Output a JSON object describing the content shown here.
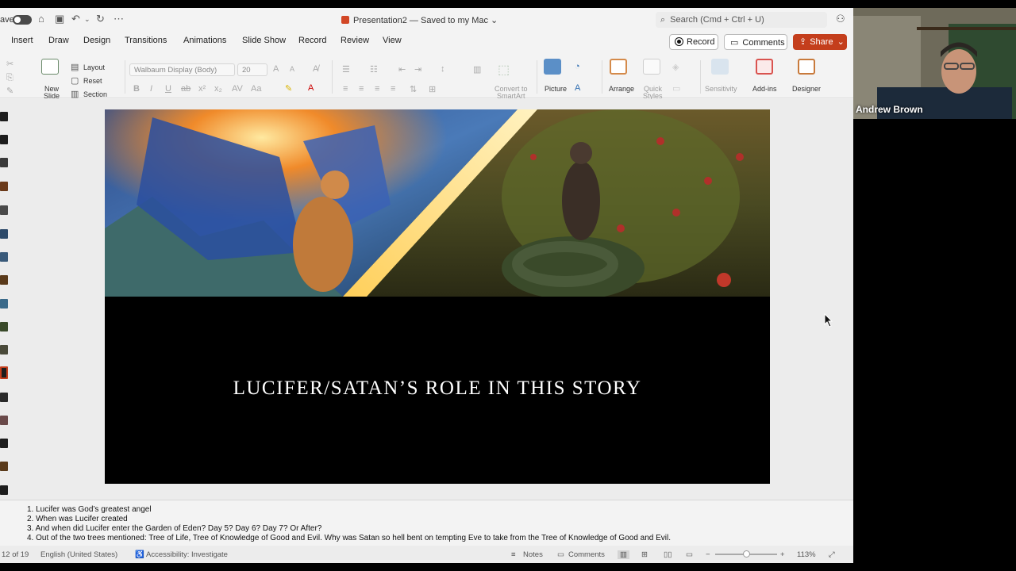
{
  "titlebar": {
    "autosave_label": "ave",
    "document_title": "Presentation2 — Saved to my Mac ⌄",
    "search_placeholder": "Search (Cmd + Ctrl + U)"
  },
  "tabs": [
    "Insert",
    "Draw",
    "Design",
    "Transitions",
    "Animations",
    "Slide Show",
    "Record",
    "Review",
    "View"
  ],
  "header_buttons": {
    "record": "Record",
    "comments": "Comments",
    "share": "Share"
  },
  "ribbon": {
    "new_slide": "New",
    "new_slide_2": "Slide",
    "layout": "Layout",
    "reset": "Reset",
    "section": "Section",
    "font_name": "Walbaum Display (Body)",
    "font_size": "20",
    "convert_smartart_1": "Convert to",
    "convert_smartart_2": "SmartArt",
    "picture": "Picture",
    "arrange": "Arrange",
    "quick_styles_1": "Quick",
    "quick_styles_2": "Styles",
    "sensitivity": "Sensitivity",
    "addins": "Add-ins",
    "designer": "Designer"
  },
  "slide": {
    "title": "LUCIFER/SATAN’S ROLE IN THIS STORY"
  },
  "notes": [
    "1.  Lucifer was God’s greatest angel",
    "2.  When was Lucifer created",
    "3.  And when did Lucifer enter the Garden of Eden? Day 5? Day 6? Day 7? Or After?",
    "4.  Out of the two trees mentioned: Tree of Life, Tree of Knowledge of Good and Evil. Why was Satan so hell bent on tempting Eve to take from the Tree of Knowledge of Good and Evil."
  ],
  "status": {
    "slide_counter": "12 of 19",
    "language": "English (United States)",
    "accessibility": "Accessibility: Investigate",
    "notes": "Notes",
    "comments": "Comments",
    "zoom": "113%"
  },
  "video": {
    "participant_name": "Andrew Brown"
  }
}
